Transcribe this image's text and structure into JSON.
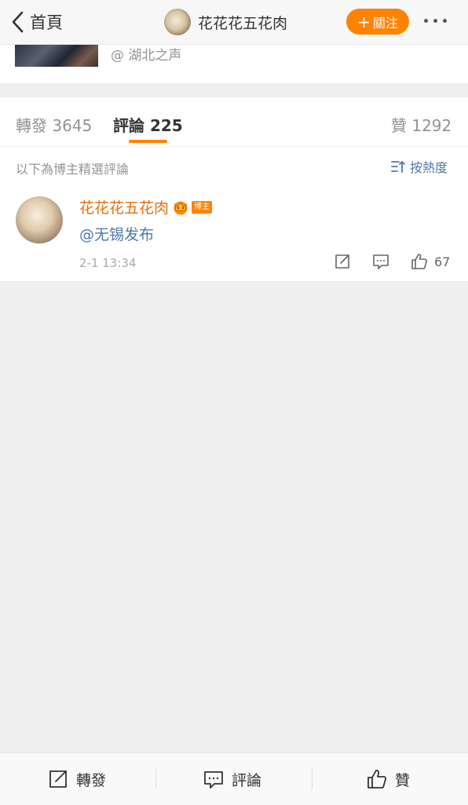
{
  "nav": {
    "back_label": "首頁",
    "title": "花花花五花肉",
    "follow_label": "關注"
  },
  "source": {
    "text": "@ 湖北之声"
  },
  "tabs": [
    {
      "label": "轉發",
      "count": "3645"
    },
    {
      "label": "評論",
      "count": "225"
    },
    {
      "label": "贊",
      "count": "1292"
    }
  ],
  "comments_header": {
    "subtitle": "以下為博主精選評論",
    "sort_label": "按熱度"
  },
  "comment": {
    "author": "花花花五花肉",
    "badge": "博主",
    "text": "@无锡发布",
    "time": "2-1 13:34",
    "likes": "67"
  },
  "bottom_bar": {
    "repost": "轉發",
    "comment": "評論",
    "like": "贊"
  },
  "colors": {
    "accent": "#ff8200",
    "link": "#4e79a8",
    "author": "#e86b0c"
  }
}
